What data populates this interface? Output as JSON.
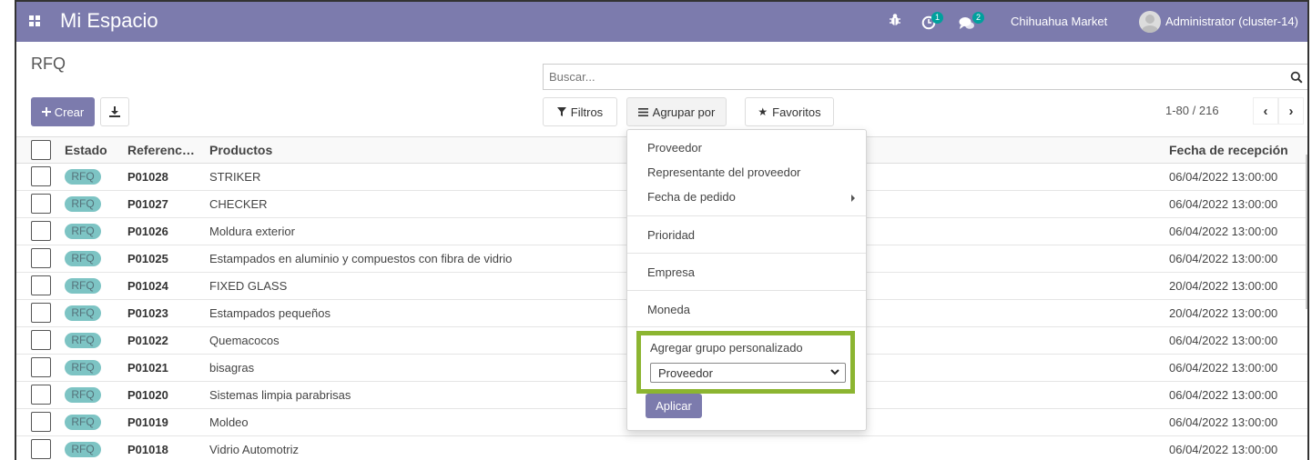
{
  "navbar": {
    "app_title": "Mi Espacio",
    "activity_count": "1",
    "messages_count": "2",
    "company": "Chihuahua Market",
    "user": "Administrator (cluster-14)",
    "color": "#7c7bad"
  },
  "control_panel": {
    "breadcrumb": "RFQ",
    "search_placeholder": "Buscar...",
    "create_label": "Crear",
    "filters_label": "Filtros",
    "group_by_label": "Agrupar por",
    "favorites_label": "Favoritos",
    "pager": "1-80 / 216"
  },
  "table": {
    "headers": [
      "Estado",
      "Referenc…",
      "Productos",
      "Fecha de recepción"
    ],
    "rows": [
      {
        "status": "RFQ",
        "ref": "P01028",
        "product": "STRIKER",
        "date": "06/04/2022 13:00:00"
      },
      {
        "status": "RFQ",
        "ref": "P01027",
        "product": "CHECKER",
        "date": "06/04/2022 13:00:00"
      },
      {
        "status": "RFQ",
        "ref": "P01026",
        "product": "Moldura exterior",
        "date": "06/04/2022 13:00:00"
      },
      {
        "status": "RFQ",
        "ref": "P01025",
        "product": "Estampados en aluminio y compuestos con fibra de vidrio",
        "date": "06/04/2022 13:00:00"
      },
      {
        "status": "RFQ",
        "ref": "P01024",
        "product": "FIXED GLASS",
        "date": "20/04/2022 13:00:00"
      },
      {
        "status": "RFQ",
        "ref": "P01023",
        "product": "Estampados pequeños",
        "date": "20/04/2022 13:00:00"
      },
      {
        "status": "RFQ",
        "ref": "P01022",
        "product": "Quemacocos",
        "date": "06/04/2022 13:00:00"
      },
      {
        "status": "RFQ",
        "ref": "P01021",
        "product": "bisagras",
        "date": "06/04/2022 13:00:00"
      },
      {
        "status": "RFQ",
        "ref": "P01020",
        "product": "Sistemas limpia parabrisas",
        "date": "06/04/2022 13:00:00"
      },
      {
        "status": "RFQ",
        "ref": "P01019",
        "product": "Moldeo",
        "date": "06/04/2022 13:00:00"
      },
      {
        "status": "RFQ",
        "ref": "P01018",
        "product": "Vidrio Automotriz",
        "date": "06/04/2022 13:00:00"
      }
    ]
  },
  "group_by_menu": {
    "items": [
      "Proveedor",
      "Representante del proveedor",
      "Fecha de pedido",
      "Prioridad",
      "Empresa",
      "Moneda"
    ],
    "custom_group_label": "Agregar grupo personalizado",
    "custom_group_selected": "Proveedor",
    "apply_label": "Aplicar",
    "highlight_color": "#8cb531"
  }
}
